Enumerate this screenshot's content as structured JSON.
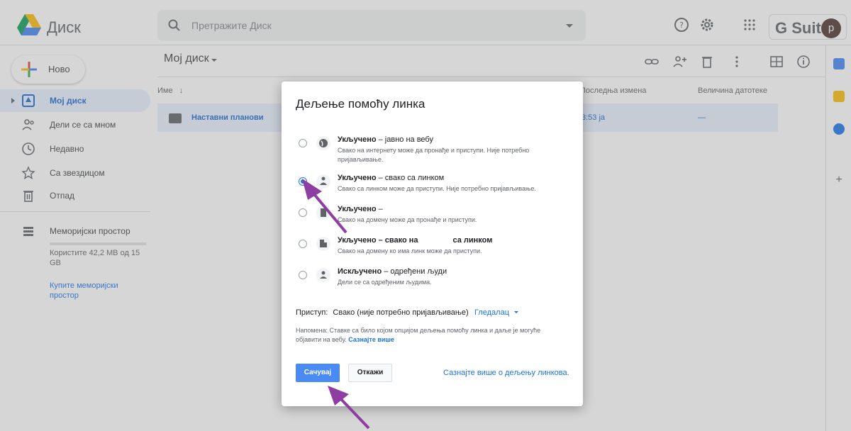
{
  "header": {
    "app_title": "Диск",
    "search_placeholder": "Претражите Диск",
    "suite_label": "G Suite",
    "avatar_letter": "p"
  },
  "sidebar": {
    "new_label": "Ново",
    "items": [
      {
        "label": "Мој диск",
        "active": true
      },
      {
        "label": "Дели се са мном"
      },
      {
        "label": "Недавно"
      },
      {
        "label": "Са звездицом"
      },
      {
        "label": "Отпад"
      }
    ],
    "storage_label": "Меморијски простор",
    "storage_usage": "Користите 42,2 MB од 15 GB",
    "buy_storage": "Купите меморијски простор"
  },
  "main": {
    "breadcrumb": "Мој диск",
    "columns": {
      "name": "Име",
      "modified": "Последња измена",
      "size": "Величина датотеке"
    },
    "rows": [
      {
        "name": "Наставни планови",
        "modified": "3:53 ја",
        "size": "—"
      }
    ]
  },
  "dialog": {
    "title": "Дељење помоћу линка",
    "options": [
      {
        "title_bold": "Укључено",
        "title_rest": " – јавно на вебу",
        "desc": "Свако на интернету може да пронађе и приступи. Није потребно пријављивање.",
        "icon": "globe-icon",
        "checked": false
      },
      {
        "title_bold": "Укључено",
        "title_rest": " – свако са линком",
        "desc": "Свако са линком може да приступи. Није потребно пријављивање.",
        "icon": "link-user-icon",
        "checked": true
      },
      {
        "title_bold": "Укључено",
        "title_rest": " –",
        "desc": "Свако на домену                 може да пронађе и приступи.",
        "icon": "domain-icon",
        "checked": false
      },
      {
        "title_bold": "Укључено – свако на",
        "title_rest": "                са линком",
        "desc": "Свако на домену            ко има линк може да приступи.",
        "icon": "domain-link-icon",
        "checked": false
      },
      {
        "title_bold": "Искључено",
        "title_rest": " – одређени људи",
        "desc": "Дели се са одређеним људима.",
        "icon": "person-icon",
        "checked": false
      }
    ],
    "access_label": "Приступ:",
    "access_value": "Свако (није потребно пријављивање)",
    "access_role": "Гледалац",
    "note_text": "Напомена: Ставке са било којом опцијом дељења помоћу линка и даље је могуће објавити на вебу.",
    "note_link": "Сазнајте више",
    "save_label": "Сачувај",
    "cancel_label": "Откажи",
    "learn_more": "Сазнајте више о дељењу линкова."
  },
  "colors": {
    "accent": "#1a73e8",
    "save_button": "#4a8af4",
    "annotation_arrow": "#8e3ea3"
  }
}
